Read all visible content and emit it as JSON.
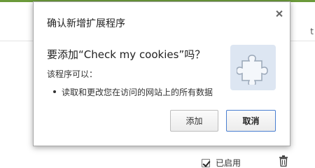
{
  "background": {
    "side_text": "t",
    "enabled_label": "已启用"
  },
  "dialog": {
    "title": "确认新增扩展程序",
    "question": "要添加“Check my cookies”吗？",
    "permissions_heading": "该程序可以：",
    "permissions": [
      "读取和更改您在访问的网站上的所有数据"
    ],
    "add_label": "添加",
    "cancel_label": "取消",
    "icon": "puzzle-piece-icon"
  },
  "colors": {
    "accent_bar": "#6b9a3a",
    "focus_border": "#4a7fd1",
    "icon_bg": "#dde6f2"
  }
}
